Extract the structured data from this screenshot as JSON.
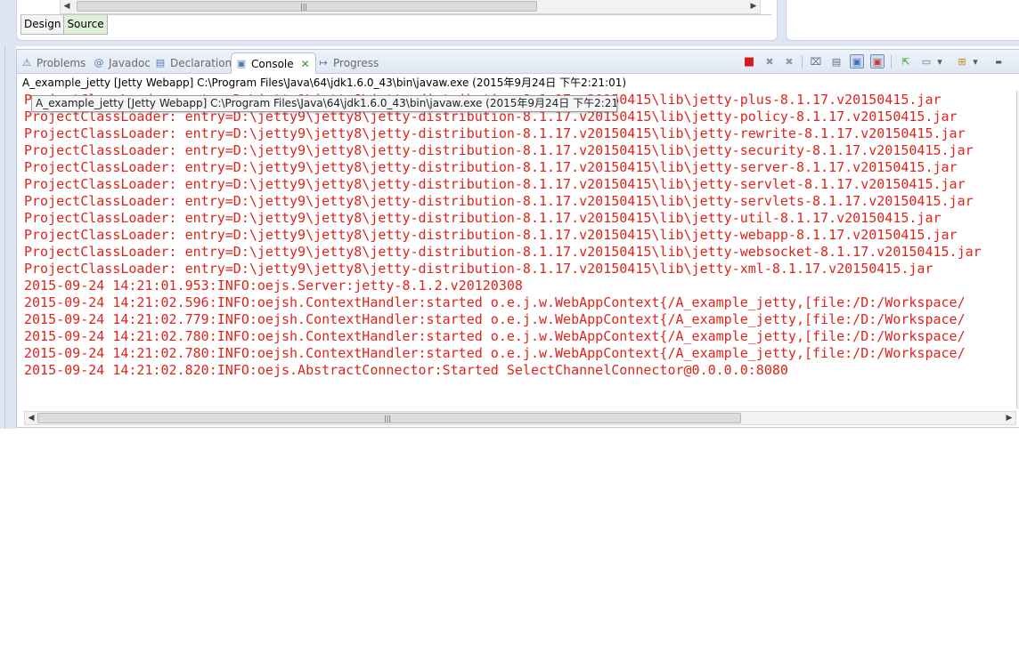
{
  "editor": {
    "tabs": [
      {
        "label": "Design",
        "active": false
      },
      {
        "label": "Source",
        "active": true
      }
    ],
    "scroll_grip": "|||"
  },
  "console": {
    "tabs": [
      {
        "label": "Problems",
        "icon": "problems-icon",
        "active": false
      },
      {
        "label": "Javadoc",
        "icon": "javadoc-icon",
        "active": false
      },
      {
        "label": "Declaration",
        "icon": "declaration-icon",
        "active": false
      },
      {
        "label": "Console",
        "icon": "console-icon",
        "active": true
      },
      {
        "label": "Progress",
        "icon": "progress-icon",
        "active": false
      }
    ],
    "process_label": "A_example_jetty [Jetty Webapp] C:\\Program Files\\Java\\64\\jdk1.6.0_43\\bin\\javaw.exe (2015年9月24日 下午2:21:01)",
    "tooltip": "A_example_jetty [Jetty Webapp] C:\\Program Files\\Java\\64\\jdk1.6.0_43\\bin\\javaw.exe (2015年9月24日 下午2:21:01)",
    "log_color": "#e0241b",
    "log_lines": [
      "ProjectClassLoader: entry=D:\\jetty9\\jetty8\\jetty-distribution-8.1.17.v20150415\\lib\\jetty-plus-8.1.17.v20150415.jar",
      "ProjectClassLoader: entry=D:\\jetty9\\jetty8\\jetty-distribution-8.1.17.v20150415\\lib\\jetty-policy-8.1.17.v20150415.jar",
      "ProjectClassLoader: entry=D:\\jetty9\\jetty8\\jetty-distribution-8.1.17.v20150415\\lib\\jetty-rewrite-8.1.17.v20150415.jar",
      "ProjectClassLoader: entry=D:\\jetty9\\jetty8\\jetty-distribution-8.1.17.v20150415\\lib\\jetty-security-8.1.17.v20150415.jar",
      "ProjectClassLoader: entry=D:\\jetty9\\jetty8\\jetty-distribution-8.1.17.v20150415\\lib\\jetty-server-8.1.17.v20150415.jar",
      "ProjectClassLoader: entry=D:\\jetty9\\jetty8\\jetty-distribution-8.1.17.v20150415\\lib\\jetty-servlet-8.1.17.v20150415.jar",
      "ProjectClassLoader: entry=D:\\jetty9\\jetty8\\jetty-distribution-8.1.17.v20150415\\lib\\jetty-servlets-8.1.17.v20150415.jar",
      "ProjectClassLoader: entry=D:\\jetty9\\jetty8\\jetty-distribution-8.1.17.v20150415\\lib\\jetty-util-8.1.17.v20150415.jar",
      "ProjectClassLoader: entry=D:\\jetty9\\jetty8\\jetty-distribution-8.1.17.v20150415\\lib\\jetty-webapp-8.1.17.v20150415.jar",
      "ProjectClassLoader: entry=D:\\jetty9\\jetty8\\jetty-distribution-8.1.17.v20150415\\lib\\jetty-websocket-8.1.17.v20150415.jar",
      "ProjectClassLoader: entry=D:\\jetty9\\jetty8\\jetty-distribution-8.1.17.v20150415\\lib\\jetty-xml-8.1.17.v20150415.jar",
      "2015-09-24 14:21:01.953:INFO:oejs.Server:jetty-8.1.2.v20120308",
      "2015-09-24 14:21:02.596:INFO:oejsh.ContextHandler:started o.e.j.w.WebAppContext{/A_example_jetty,[file:/D:/Workspace/",
      "2015-09-24 14:21:02.779:INFO:oejsh.ContextHandler:started o.e.j.w.WebAppContext{/A_example_jetty,[file:/D:/Workspace/",
      "2015-09-24 14:21:02.780:INFO:oejsh.ContextHandler:started o.e.j.w.WebAppContext{/A_example_jetty,[file:/D:/Workspace/",
      "2015-09-24 14:21:02.780:INFO:oejsh.ContextHandler:started o.e.j.w.WebAppContext{/A_example_jetty,[file:/D:/Workspace/",
      "2015-09-24 14:21:02.820:INFO:oejs.AbstractConnector:Started SelectChannelConnector@0.0.0.0:8080"
    ],
    "toolbar": [
      {
        "name": "terminate-icon",
        "glyph": "■",
        "color": "#d41a1a"
      },
      {
        "name": "remove-launch-icon",
        "glyph": "✖",
        "color": "#8a9aae"
      },
      {
        "name": "remove-all-terminated-icon",
        "glyph": "✖",
        "color": "#8a9aae"
      },
      {
        "name": "clear-console-icon",
        "glyph": "⌧",
        "color": "#5a6f8e"
      },
      {
        "name": "scroll-lock-icon",
        "glyph": "▤",
        "color": "#5a6f8e"
      },
      {
        "name": "show-stdout-icon",
        "glyph": "▣",
        "color": "#3f6fb5"
      },
      {
        "name": "show-stderr-icon",
        "glyph": "▣",
        "color": "#c43a3a"
      },
      {
        "name": "pin-console-icon",
        "glyph": "⇱",
        "color": "#3f8f3f"
      },
      {
        "name": "display-selected-console-icon",
        "glyph": "▭",
        "color": "#5a6f8e"
      },
      {
        "name": "display-selected-console-dropdown-icon",
        "glyph": "▾",
        "color": "#333"
      },
      {
        "name": "open-console-icon",
        "glyph": "⊞",
        "color": "#b58a1a"
      },
      {
        "name": "open-console-dropdown-icon",
        "glyph": "▾",
        "color": "#333"
      },
      {
        "name": "minimize-icon",
        "glyph": "▬",
        "color": "#333"
      }
    ],
    "scroll_grip": "|||"
  }
}
